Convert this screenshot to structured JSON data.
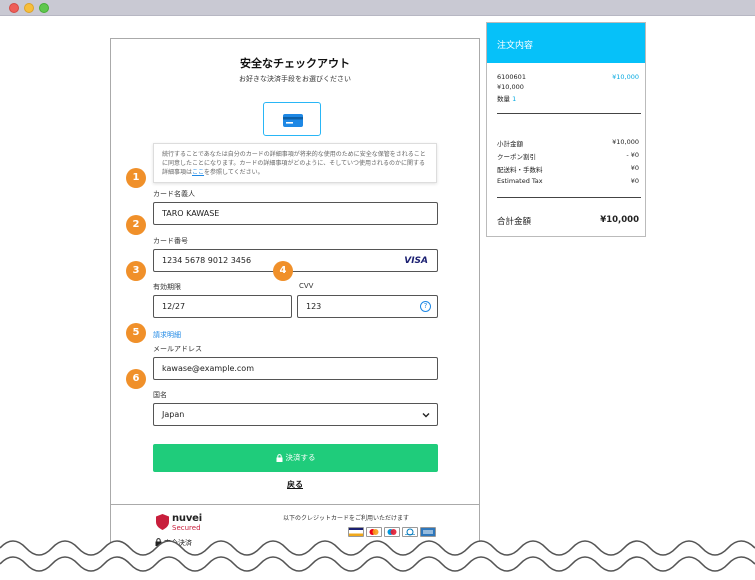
{
  "checkout": {
    "title": "安全なチェックアウト",
    "subtitle": "お好きな決済手段をお選びください",
    "notice_text": "続行することであなたは自分のカードの詳細事項が将来的な使用のために安全な保管をされることに同意したことになります。カードの詳細事項がどのように、そしていつ使用されるのかに関する詳細事項は",
    "notice_link": "ここ",
    "notice_suffix": "を参照してください。",
    "fields": {
      "cardholder": {
        "badge": "1",
        "label": "カード名義人",
        "value": "TARO KAWASE"
      },
      "card_number": {
        "badge": "2",
        "label": "カード番号",
        "value": "1234 5678 9012 3456",
        "brand": "VISA"
      },
      "expiry": {
        "badge": "3",
        "label": "有効期限",
        "value": "12/27"
      },
      "cvv": {
        "badge": "4",
        "label": "CVV",
        "value": "123",
        "help": "?"
      },
      "email": {
        "badge": "5",
        "label": "メールアドレス",
        "value": "kawase@example.com"
      },
      "country": {
        "badge": "6",
        "label": "国名",
        "value": "Japan"
      }
    },
    "billing_label": "請求明細",
    "pay_button": "決済する",
    "back_link": "戻る",
    "footer": {
      "brand_name": "nuvei",
      "brand_secured": "Secured",
      "secure_payment": "安全決済",
      "cards_caption": "以下のクレジットカードをご利用いただけます",
      "card_brands": [
        "visa-icon",
        "mastercard-icon",
        "maestro-icon",
        "diners-icon",
        "amex-icon"
      ]
    }
  },
  "order": {
    "title": "注文内容",
    "item_code": "6100601",
    "item_price": "¥10,000",
    "item_unit_price": "¥10,000",
    "qty_label": "数量",
    "qty_value": "1",
    "rows": [
      {
        "label": "小計金額",
        "value": "¥10,000"
      },
      {
        "label": "クーポン割引",
        "value": "- ¥0"
      },
      {
        "label": "配送料・手数料",
        "value": "¥0"
      },
      {
        "label": "Estimated Tax",
        "value": "¥0"
      }
    ],
    "total_label": "合計金額",
    "total_value": "¥10,000"
  },
  "colors": {
    "accent_blue": "#06c1f9",
    "pay_green": "#1fcc7b",
    "badge_orange": "#f0902a",
    "link_blue": "#1e88e5"
  }
}
